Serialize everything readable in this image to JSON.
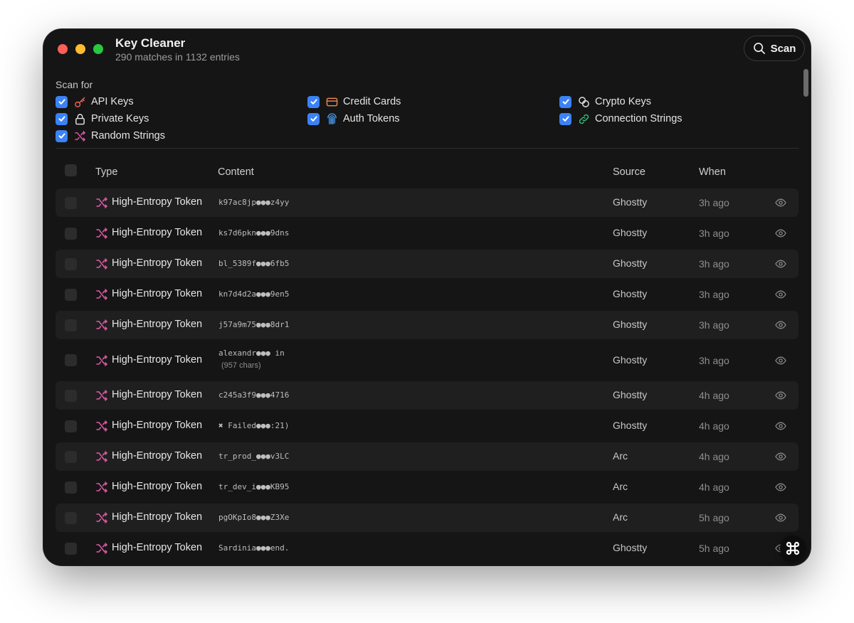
{
  "window": {
    "title": "Key Cleaner",
    "subtitle": "290 matches in 1132 entries",
    "scan_label": "Scan"
  },
  "scan_for": {
    "label": "Scan for",
    "options": [
      {
        "label": "API Keys",
        "icon": "key-icon",
        "color": "#f0655a",
        "checked": true
      },
      {
        "label": "Credit Cards",
        "icon": "credit-card-icon",
        "color": "#f08a4b",
        "checked": true
      },
      {
        "label": "Crypto Keys",
        "icon": "crypto-coins-icon",
        "color": "#e4e4e4",
        "checked": true
      },
      {
        "label": "Private Keys",
        "icon": "lock-icon",
        "color": "#e4e4e4",
        "checked": true
      },
      {
        "label": "Auth Tokens",
        "icon": "fingerprint-icon",
        "color": "#4aa3ff",
        "checked": true
      },
      {
        "label": "Connection Strings",
        "icon": "link-icon",
        "color": "#34c77b",
        "checked": true
      },
      {
        "label": "Random Strings",
        "icon": "shuffle-icon",
        "color": "#e25aa8",
        "checked": true
      }
    ]
  },
  "table": {
    "headers": {
      "type": "Type",
      "content": "Content",
      "source": "Source",
      "when": "When"
    },
    "rows": [
      {
        "type": "High-Entropy Token",
        "content": "k97ac8jp●●●z4yy",
        "source": "Ghostty",
        "when": "3h ago"
      },
      {
        "type": "High-Entropy Token",
        "content": "ks7d6pkn●●●9dns",
        "source": "Ghostty",
        "when": "3h ago"
      },
      {
        "type": "High-Entropy Token",
        "content": "bl_5389f●●●6fb5",
        "source": "Ghostty",
        "when": "3h ago"
      },
      {
        "type": "High-Entropy Token",
        "content": "kn7d4d2a●●●9en5",
        "source": "Ghostty",
        "when": "3h ago"
      },
      {
        "type": "High-Entropy Token",
        "content": "j57a9m75●●●8dr1",
        "source": "Ghostty",
        "when": "3h ago"
      },
      {
        "type": "High-Entropy Token",
        "content": "alexandr●●● in",
        "extra": "(957 chars)",
        "source": "Ghostty",
        "when": "3h ago"
      },
      {
        "type": "High-Entropy Token",
        "content": "c245a3f9●●●4716",
        "source": "Ghostty",
        "when": "4h ago"
      },
      {
        "type": "High-Entropy Token",
        "content": "✖ Failed●●●:21)",
        "source": "Ghostty",
        "when": "4h ago"
      },
      {
        "type": "High-Entropy Token",
        "content": "tr_prod_●●●v3LC",
        "source": "Arc",
        "when": "4h ago"
      },
      {
        "type": "High-Entropy Token",
        "content": "tr_dev_i●●●KB95",
        "source": "Arc",
        "when": "4h ago"
      },
      {
        "type": "High-Entropy Token",
        "content": "pgOKpIo8●●●Z3Xe",
        "source": "Arc",
        "when": "5h ago"
      },
      {
        "type": "High-Entropy Token",
        "content": "Sardinia●●●end.",
        "source": "Ghostty",
        "when": "5h ago"
      }
    ]
  },
  "colors": {
    "accent": "#3b82f6",
    "type_icon": "#e25aa8",
    "background": "#151515"
  }
}
